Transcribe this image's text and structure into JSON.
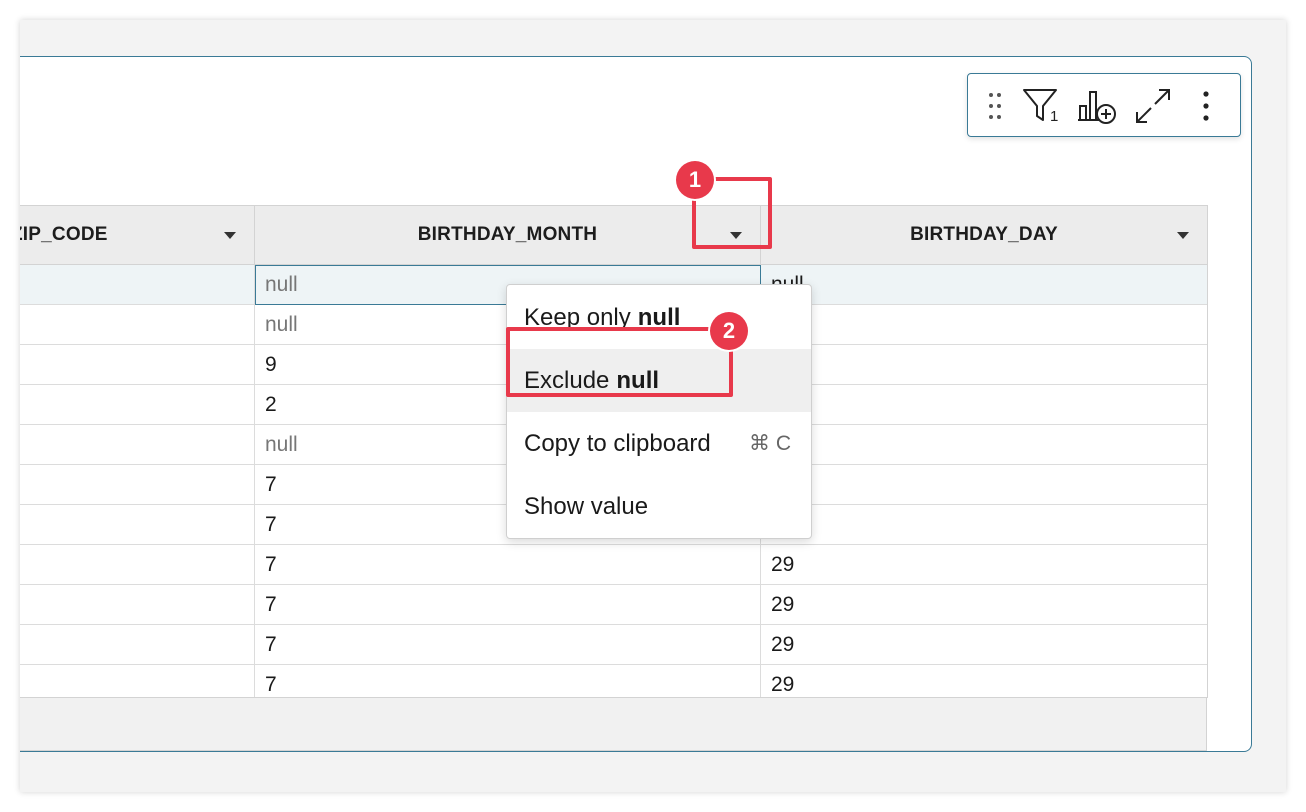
{
  "toolbar": {
    "icons": [
      "drag-handle-icon",
      "filter-icon",
      "add-chart-icon",
      "expand-icon",
      "more-options-icon"
    ],
    "filter_count": "1"
  },
  "table": {
    "columns": [
      {
        "label": "ZIP_CODE"
      },
      {
        "label": "BIRTHDAY_MONTH"
      },
      {
        "label": "BIRTHDAY_DAY"
      }
    ],
    "rows": [
      {
        "zip": "",
        "month": "null",
        "day": "null"
      },
      {
        "zip": "",
        "month": "null",
        "day": ""
      },
      {
        "zip": "",
        "month": "9",
        "day": ""
      },
      {
        "zip": "",
        "month": "2",
        "day": ""
      },
      {
        "zip": "",
        "month": "null",
        "day": ""
      },
      {
        "zip": "",
        "month": "7",
        "day": ""
      },
      {
        "zip": "",
        "month": "7",
        "day": ""
      },
      {
        "zip": "",
        "month": "7",
        "day": "29"
      },
      {
        "zip": "",
        "month": "7",
        "day": "29"
      },
      {
        "zip": "",
        "month": "7",
        "day": "29"
      },
      {
        "zip": "",
        "month": "7",
        "day": "29"
      }
    ]
  },
  "context_menu": {
    "items": [
      {
        "prefix": "Keep only",
        "bold": "null"
      },
      {
        "prefix": "Exclude",
        "bold": "null"
      },
      {
        "prefix": "Copy to clipboard",
        "bold": "",
        "shortcut": "⌘ C"
      },
      {
        "prefix": "Show value",
        "bold": ""
      }
    ]
  },
  "annotations": {
    "step1": "1",
    "step2": "2",
    "highlight_color": "#e8394b"
  },
  "colors": {
    "accent": "#3a7a96",
    "header_bg": "#ececec",
    "selected_row_bg": "#eef4f6"
  }
}
